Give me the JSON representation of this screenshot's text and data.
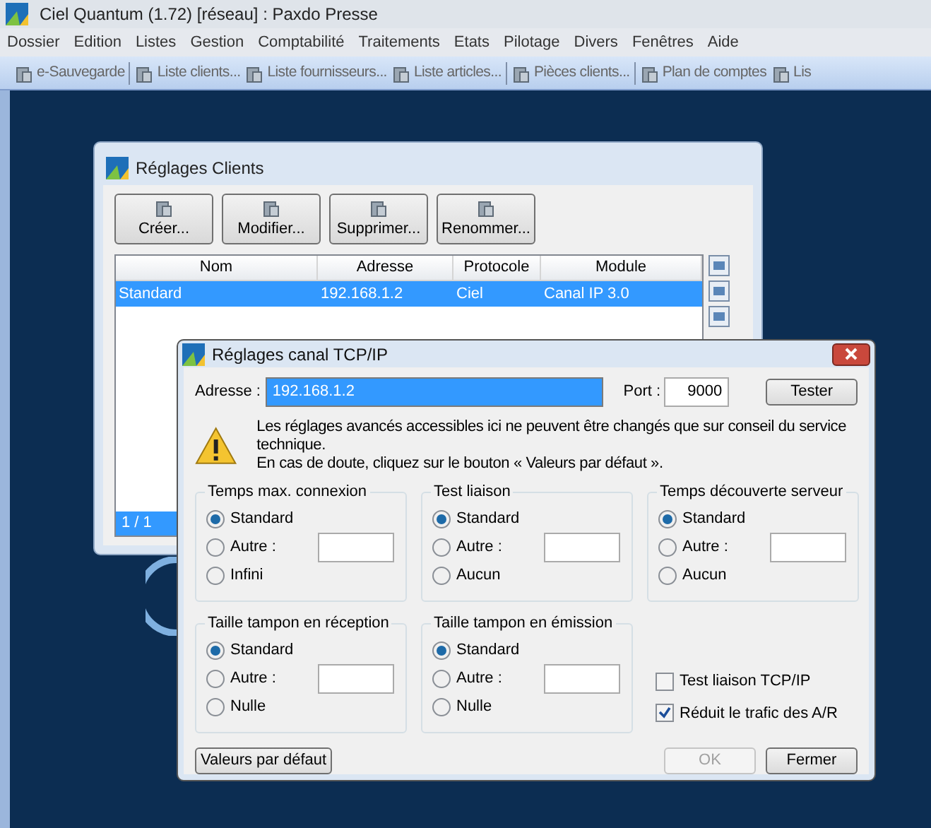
{
  "window": {
    "title": "Ciel Quantum (1.72) [réseau] : Paxdo Presse"
  },
  "menu": [
    "Dossier",
    "Edition",
    "Listes",
    "Gestion",
    "Comptabilité",
    "Traitements",
    "Etats",
    "Pilotage",
    "Divers",
    "Fenêtres",
    "Aide"
  ],
  "toolbar": [
    {
      "label": "e-Sauvegarde",
      "separator_after": true
    },
    {
      "label": "Liste clients...",
      "separator_after": false
    },
    {
      "label": "Liste fournisseurs...",
      "separator_after": false
    },
    {
      "label": "Liste articles...",
      "separator_after": true
    },
    {
      "label": "Pièces clients...",
      "separator_after": true
    },
    {
      "label": "Plan de comptes",
      "separator_after": false
    },
    {
      "label": "Lis",
      "separator_after": false
    }
  ],
  "clients_dialog": {
    "title": "Réglages Clients",
    "buttons": [
      "Créer...",
      "Modifier...",
      "Supprimer...",
      "Renommer..."
    ],
    "table": {
      "columns": [
        "Nom",
        "Adresse",
        "Protocole",
        "Module"
      ],
      "rows": [
        {
          "cells": [
            "Standard",
            "192.168.1.2",
            "Ciel",
            "Canal IP 3.0"
          ],
          "selected": true
        }
      ]
    },
    "footer": "1 / 1"
  },
  "tcp_dialog": {
    "title": "Réglages canal TCP/IP",
    "address_label": "Adresse :",
    "address": "192.168.1.2",
    "port_label": "Port :",
    "port": "9000",
    "test_button": "Tester",
    "warning": [
      "Les réglages avancés accessibles ici ne peuvent être changés que sur conseil du service technique.",
      "En cas de doute, cliquez sur le bouton « Valeurs par défaut »."
    ],
    "groups": [
      {
        "title": "Temps max. connexion",
        "options": [
          {
            "label": "Standard",
            "kind": "radio",
            "selected": true
          },
          {
            "label": "Autre :",
            "kind": "radio_input",
            "selected": false
          },
          {
            "label": "Infini",
            "kind": "radio",
            "selected": false
          }
        ]
      },
      {
        "title": "Test liaison",
        "options": [
          {
            "label": "Standard",
            "kind": "radio",
            "selected": true
          },
          {
            "label": "Autre :",
            "kind": "radio_input",
            "selected": false
          },
          {
            "label": "Aucun",
            "kind": "radio",
            "selected": false
          }
        ]
      },
      {
        "title": "Temps découverte serveur",
        "options": [
          {
            "label": "Standard",
            "kind": "radio",
            "selected": true
          },
          {
            "label": "Autre :",
            "kind": "radio_input",
            "selected": false
          },
          {
            "label": "Aucun",
            "kind": "radio",
            "selected": false
          }
        ]
      },
      {
        "title": "Taille tampon en réception",
        "options": [
          {
            "label": "Standard",
            "kind": "radio",
            "selected": true
          },
          {
            "label": "Autre :",
            "kind": "radio_input",
            "selected": false
          },
          {
            "label": "Nulle",
            "kind": "radio",
            "selected": false
          }
        ]
      },
      {
        "title": "Taille tampon en émission",
        "options": [
          {
            "label": "Standard",
            "kind": "radio",
            "selected": true
          },
          {
            "label": "Autre :",
            "kind": "radio_input",
            "selected": false
          },
          {
            "label": "Nulle",
            "kind": "radio",
            "selected": false
          }
        ]
      }
    ],
    "checkboxes": [
      {
        "label": "Test liaison TCP/IP",
        "checked": false
      },
      {
        "label": "Réduit le trafic des A/R",
        "checked": true
      }
    ],
    "defaults_button": "Valeurs par défaut",
    "ok_button": {
      "label": "OK",
      "disabled": true
    },
    "close_button": "Fermer"
  }
}
